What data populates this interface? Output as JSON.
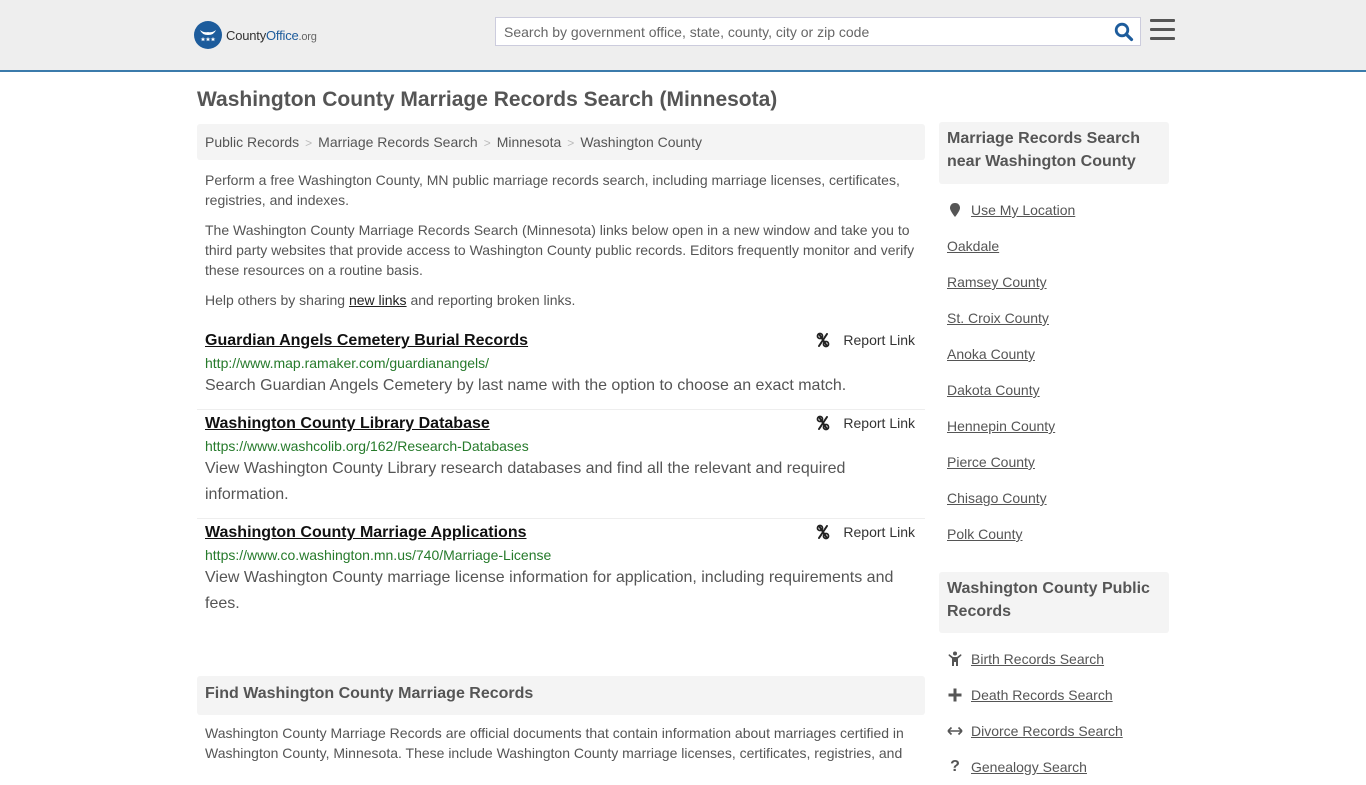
{
  "header": {
    "logo": {
      "name_prefix": "County",
      "name_main": "Office",
      "name_suffix": ".org"
    },
    "search": {
      "placeholder": "Search by government office, state, county, city or zip code",
      "value": ""
    },
    "search_icon": "search-icon",
    "menu_icon": "hamburger-menu-icon"
  },
  "page": {
    "title": "Washington County Marriage Records Search (Minnesota)",
    "breadcrumb": [
      {
        "label": "Public Records"
      },
      {
        "label": "Marriage Records Search"
      },
      {
        "label": "Minnesota"
      },
      {
        "label": "Washington County"
      }
    ],
    "breadcrumb_separator": ">",
    "intro": {
      "p1": "Perform a free Washington County, MN public marriage records search, including marriage licenses, certificates, registries, and indexes.",
      "p2": "The Washington County Marriage Records Search (Minnesota) links below open in a new window and take you to third party websites that provide access to Washington County public records. Editors frequently monitor and verify these resources on a routine basis.",
      "p3_before": "Help others by sharing ",
      "p3_link": "new links",
      "p3_after": " and reporting broken links."
    }
  },
  "results": [
    {
      "title": "Guardian Angels Cemetery Burial Records",
      "url": "http://www.map.ramaker.com/guardianangels/",
      "description": "Search Guardian Angels Cemetery by last name with the option to choose an exact match.",
      "report_label": "Report Link"
    },
    {
      "title": "Washington County Library Database",
      "url": "https://www.washcolib.org/162/Research-Databases",
      "description": "View Washington County Library research databases and find all the relevant and required information.",
      "report_label": "Report Link"
    },
    {
      "title": "Washington County Marriage Applications",
      "url": "https://www.co.washington.mn.us/740/Marriage-License",
      "description": "View Washington County marriage license information for application, including requirements and fees.",
      "report_label": "Report Link"
    }
  ],
  "find_section": {
    "heading": "Find Washington County Marriage Records",
    "text": "Washington County Marriage Records are official documents that contain information about marriages certified in Washington County, Minnesota. These include Washington County marriage licenses, certificates, registries, and"
  },
  "sidebar": {
    "nearby": {
      "heading": "Marriage Records Search near Washington County",
      "use_location": "Use My Location",
      "items": [
        "Oakdale",
        "Ramsey County",
        "St. Croix County",
        "Anoka County",
        "Dakota County",
        "Hennepin County",
        "Pierce County",
        "Chisago County",
        "Polk County"
      ]
    },
    "public_records": {
      "heading": "Washington County Public Records",
      "items": [
        {
          "label": "Birth Records Search",
          "icon": "child-icon"
        },
        {
          "label": "Death Records Search",
          "icon": "plus-icon"
        },
        {
          "label": "Divorce Records Search",
          "icon": "arrows-horizontal-icon"
        },
        {
          "label": "Genealogy Search",
          "icon": "question-icon"
        }
      ]
    }
  },
  "colors": {
    "header_bg": "#eeeeee",
    "header_border": "#3b7bab",
    "brand_blue": "#1d5c9c",
    "url_green": "#267a2b",
    "panel_bg": "#f4f4f4",
    "text": "#555555"
  }
}
